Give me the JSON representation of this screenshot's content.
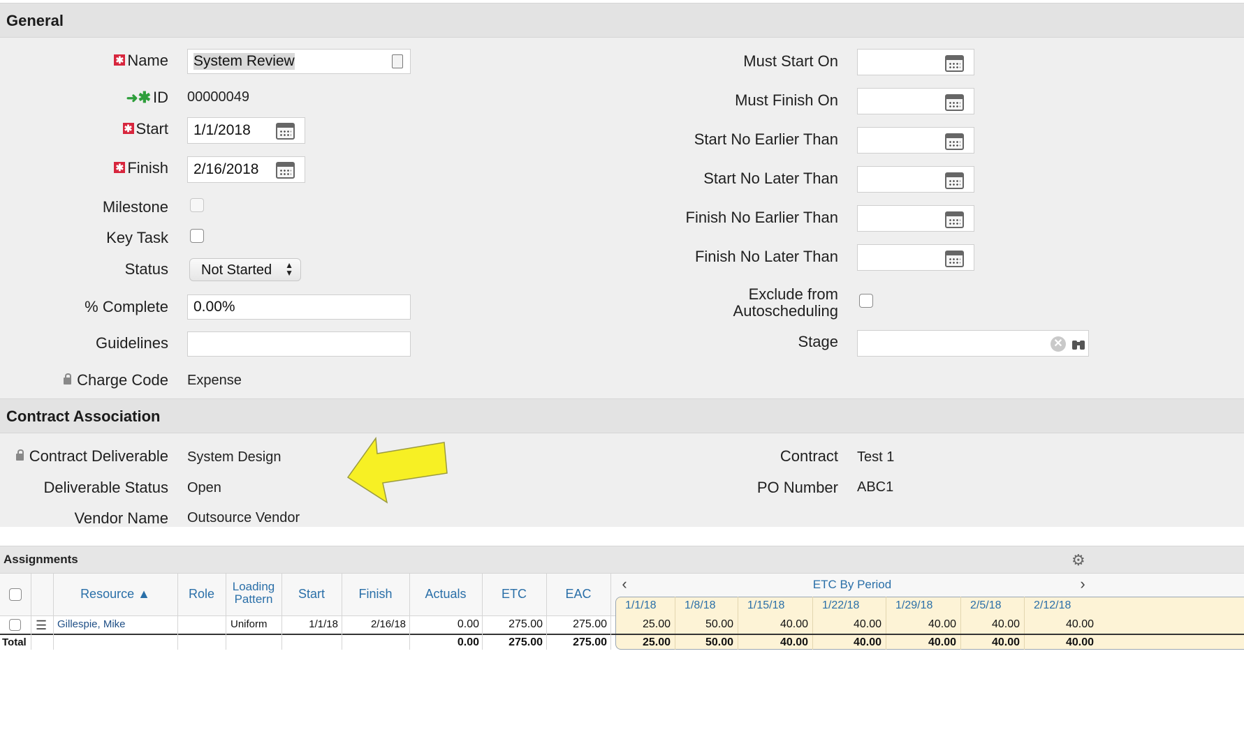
{
  "general": {
    "section_title": "General",
    "name_label": "Name",
    "name_value": "System Review",
    "id_label": "ID",
    "id_value": "00000049",
    "start_label": "Start",
    "start_value": "1/1/2018",
    "finish_label": "Finish",
    "finish_value": "2/16/2018",
    "milestone_label": "Milestone",
    "key_task_label": "Key Task",
    "status_label": "Status",
    "status_value": "Not Started",
    "pct_label": "% Complete",
    "pct_value": "0.00%",
    "guidelines_label": "Guidelines",
    "guidelines_value": "",
    "charge_code_label": "Charge Code",
    "charge_code_value": "Expense",
    "must_start_label": "Must Start On",
    "must_finish_label": "Must Finish On",
    "snet_label": "Start No Earlier Than",
    "snlt_label": "Start No Later Than",
    "fnet_label": "Finish No Earlier Than",
    "fnlt_label": "Finish No Later Than",
    "exclude_label_1": "Exclude from",
    "exclude_label_2": "Autoscheduling",
    "stage_label": "Stage",
    "stage_value": ""
  },
  "contract": {
    "section_title": "Contract Association",
    "deliverable_label": "Contract Deliverable",
    "deliverable_value": "System Design",
    "deliverable_status_label": "Deliverable Status",
    "deliverable_status_value": "Open",
    "vendor_label": "Vendor Name",
    "vendor_value": "Outsource Vendor",
    "contract_label": "Contract",
    "contract_value": "Test 1",
    "po_label": "PO Number",
    "po_value": "ABC1"
  },
  "assignments": {
    "title": "Assignments",
    "headers": {
      "resource": "Resource ▲",
      "role": "Role",
      "loading_1": "Loading",
      "loading_2": "Pattern",
      "start": "Start",
      "finish": "Finish",
      "actuals": "Actuals",
      "etc": "ETC",
      "eac": "EAC",
      "etc_by_period": "ETC By Period",
      "prev": "‹",
      "next": "›"
    },
    "periods": [
      "1/1/18",
      "1/8/18",
      "1/15/18",
      "1/22/18",
      "1/29/18",
      "2/5/18",
      "2/12/18"
    ],
    "row": {
      "resource": "Gillespie, Mike",
      "role": "",
      "loading": "Uniform",
      "start": "1/1/18",
      "finish": "2/16/18",
      "actuals": "0.00",
      "etc": "275.00",
      "eac": "275.00",
      "period_values": [
        "25.00",
        "50.00",
        "40.00",
        "40.00",
        "40.00",
        "40.00",
        "40.00"
      ]
    },
    "total": {
      "label": "Total",
      "actuals": "0.00",
      "etc": "275.00",
      "eac": "275.00",
      "period_values": [
        "25.00",
        "50.00",
        "40.00",
        "40.00",
        "40.00",
        "40.00",
        "40.00"
      ]
    }
  },
  "colors": {
    "required": "#d7263d",
    "link": "#2a6fa8",
    "arrow": "#f7f024",
    "period_bg": "#fdf3d6"
  }
}
